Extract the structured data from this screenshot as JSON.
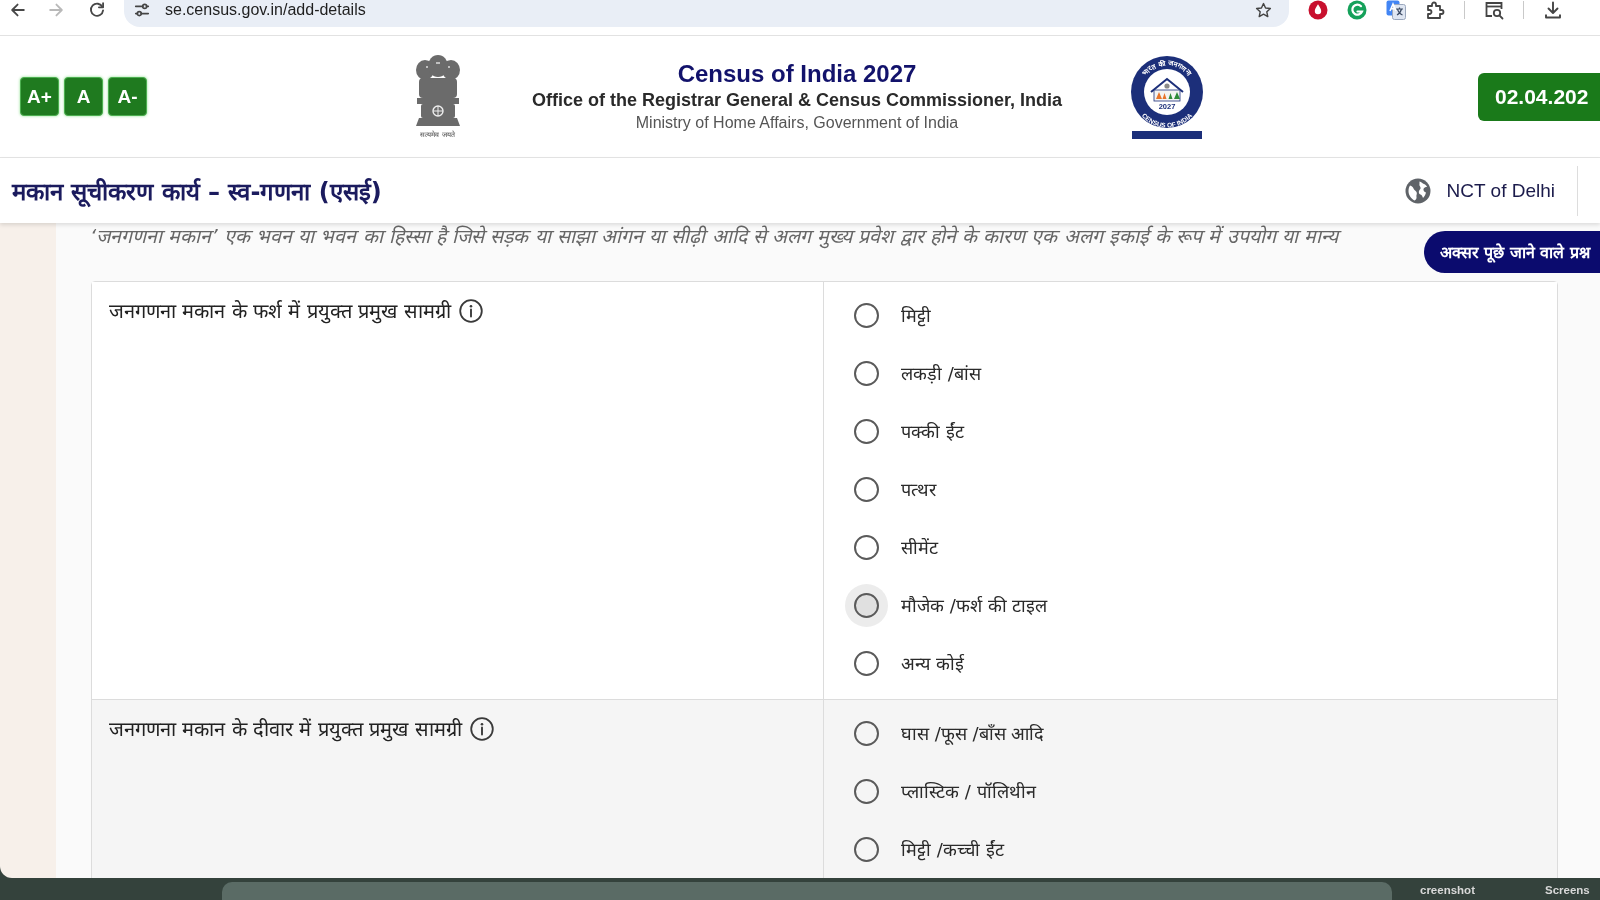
{
  "browser": {
    "url": "se.census.gov.in/add-details",
    "nav": [
      {
        "kind": "back",
        "disabled": false
      },
      {
        "kind": "forward",
        "disabled": true
      },
      {
        "kind": "reload",
        "disabled": false
      }
    ],
    "toolbar_icons": [
      {
        "kind": "drop"
      },
      {
        "kind": "ring"
      },
      {
        "kind": "translate"
      },
      {
        "kind": "puzzle"
      },
      {
        "kind": "tab-search"
      },
      {
        "kind": "download"
      }
    ]
  },
  "header": {
    "font_sizes": [
      "A+",
      "A",
      "A-"
    ],
    "emblem_caption": "सत्यमेव जयते",
    "title": "Census of India 2027",
    "subtitle": "Office of the Registrar General & Census Commissioner, India",
    "ministry": "Ministry of Home Affairs, Government of India",
    "logo": {
      "arc_top": "भारत की जनगणना",
      "year": "2027",
      "arc_bottom": "CENSUS OF INDIA"
    },
    "date": "02.04.202"
  },
  "section": {
    "title": "मकान सूचीकरण कार्य – स्व-गणना (एसई)",
    "region": "NCT of Delhi"
  },
  "intro": "‘जनगणना मकान’ एक भवन या भवन का हिस्सा है जिसे सड़क या साझा आंगन या सीढ़ी आदि से अलग मुख्य प्रवेश द्वार होने के कारण एक अलग इकाई के रूप में उपयोग या मान्य",
  "faq_button": "अक्सर पूछे जाने वाले प्रश्न",
  "questions": [
    {
      "label": "जनगणना मकान के फर्श में प्रयुक्त प्रमुख सामग्री",
      "options": [
        {
          "label": "मिट्टी",
          "selected": false,
          "hovered": false
        },
        {
          "label": "लकड़ी /बांस",
          "selected": false,
          "hovered": false
        },
        {
          "label": "पक्की ईंट",
          "selected": false,
          "hovered": false
        },
        {
          "label": "पत्थर",
          "selected": false,
          "hovered": false
        },
        {
          "label": "सीमेंट",
          "selected": false,
          "hovered": false
        },
        {
          "label": "मौजेक /फर्श की टाइल",
          "selected": false,
          "hovered": true
        },
        {
          "label": "अन्य कोई",
          "selected": false,
          "hovered": false
        }
      ]
    },
    {
      "label": "जनगणना मकान के दीवार में प्रयुक्त प्रमुख सामग्री",
      "options": [
        {
          "label": "घास /फूस /बाँस आदि",
          "selected": false,
          "hovered": false
        },
        {
          "label": "प्लास्टिक / पॉलिथीन",
          "selected": false,
          "hovered": false
        },
        {
          "label": "मिट्टी /कच्ची ईंट",
          "selected": false,
          "hovered": false
        }
      ]
    }
  ],
  "desktop": {
    "files": [
      "creenshot",
      "Screens"
    ]
  }
}
